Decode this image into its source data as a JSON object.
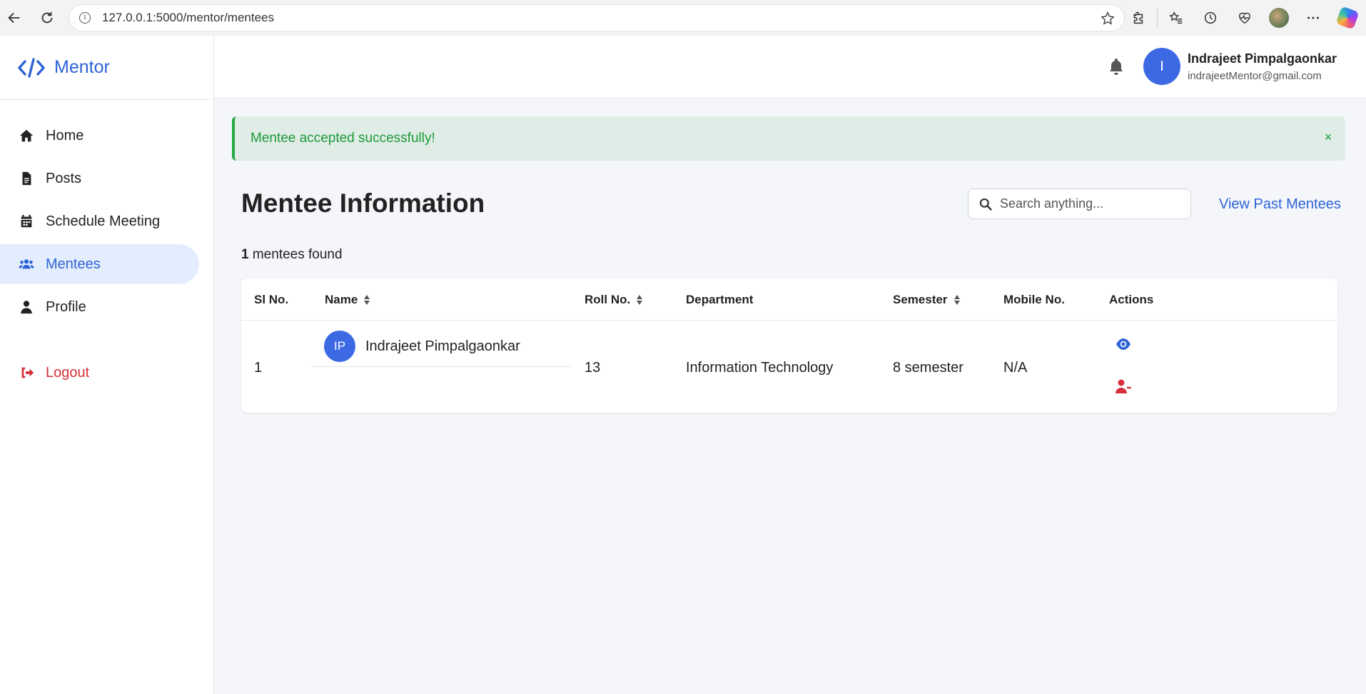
{
  "browser": {
    "url": "127.0.0.1:5000/mentor/mentees"
  },
  "brand": {
    "name": "Mentor",
    "color": "#2e63d6"
  },
  "sidebar": {
    "items": [
      {
        "label": "Home",
        "icon": "home-icon"
      },
      {
        "label": "Posts",
        "icon": "document-icon"
      },
      {
        "label": "Schedule Meeting",
        "icon": "calendar-icon"
      },
      {
        "label": "Mentees",
        "icon": "users-icon",
        "active": true
      },
      {
        "label": "Profile",
        "icon": "user-icon"
      }
    ],
    "logout": {
      "label": "Logout",
      "icon": "logout-icon"
    }
  },
  "header": {
    "user_initial": "I",
    "user_name": "Indrajeet Pimpalgaonkar",
    "user_email": "indrajeetMentor@gmail.com"
  },
  "alert": {
    "message": "Mentee accepted successfully!",
    "close": "×"
  },
  "main": {
    "title": "Mentee Information",
    "search_placeholder": "Search anything...",
    "past_link": "View Past Mentees",
    "count": "1",
    "count_suffix": " mentees found"
  },
  "table": {
    "columns": [
      "Sl No.",
      "Name",
      "Roll No.",
      "Department",
      "Semester",
      "Mobile No.",
      "Actions"
    ],
    "rows": [
      {
        "sl": "1",
        "initials": "IP",
        "name": "Indrajeet Pimpalgaonkar",
        "roll": "13",
        "department": "Information Technology",
        "semester": "8 semester",
        "mobile": "N/A"
      }
    ]
  },
  "colors": {
    "accent": "#2e63d6",
    "success": "#28a745",
    "danger": "#d6303a"
  }
}
